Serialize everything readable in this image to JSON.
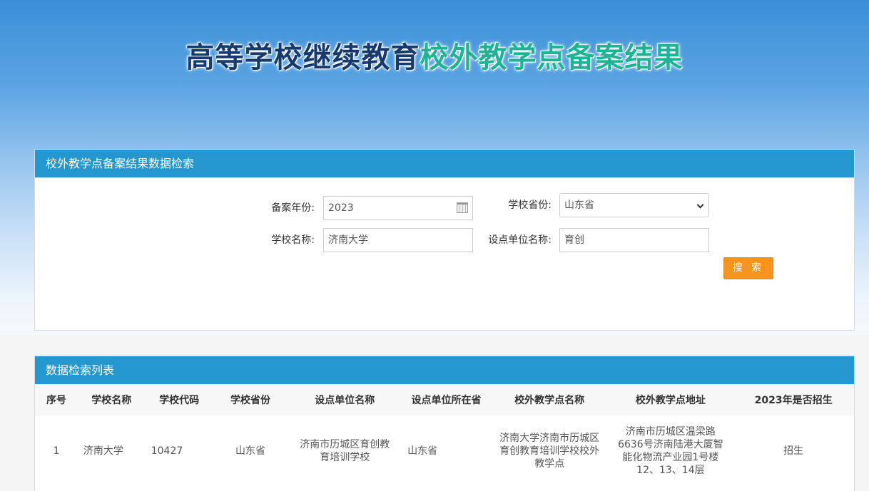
{
  "hero": {
    "title_part1": "高等学校继续教育",
    "title_part2": "校外教学点备案结果"
  },
  "search": {
    "header": "校外教学点备案结果数据检索",
    "year_label": "备案年份:",
    "year_value": "2023",
    "province_label": "学校省份:",
    "province_value": "山东省",
    "school_label": "学校名称:",
    "school_value": "济南大学",
    "unit_label": "设点单位名称:",
    "unit_value": "育创",
    "search_button": "搜 索"
  },
  "list": {
    "header": "数据检索列表",
    "columns": [
      "序号",
      "学校名称",
      "学校代码",
      "学校省份",
      "设点单位名称",
      "设点单位所在省",
      "校外教学点名称",
      "校外教学点地址",
      "2023年是否招生"
    ],
    "rows": [
      [
        "1",
        "济南大学",
        "10427",
        "山东省",
        "济南市历城区育创教育培训学校",
        "山东省",
        "济南大学济南市历城区育创教育培训学校校外教学点",
        "济南市历城区温梁路6636号济南陆港大厦智能化物流产业园1号楼12、13、14层",
        "招生"
      ]
    ]
  },
  "colors": {
    "header_blue": "#2597cf",
    "button_orange": "#f7941d",
    "title_dark": "#163a6e",
    "title_green": "#1db394"
  }
}
